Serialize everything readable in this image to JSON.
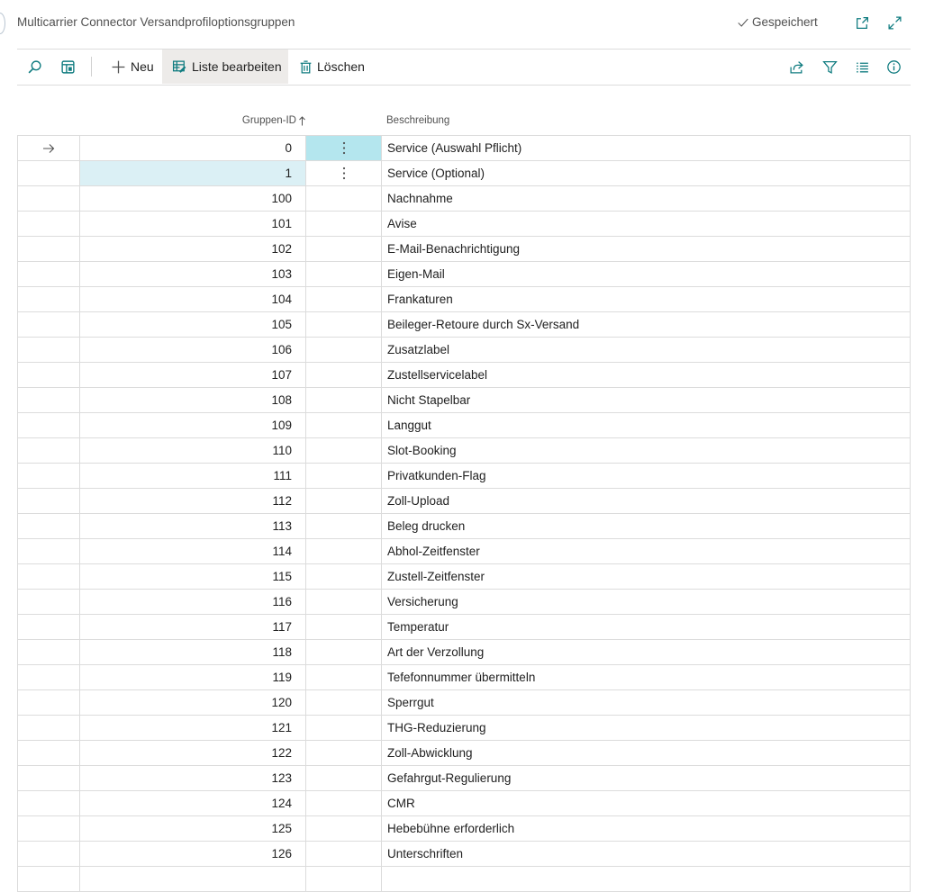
{
  "header": {
    "title": "Multicarrier Connector Versandprofiloptionsgruppen",
    "saved_label": "Gespeichert"
  },
  "toolbar": {
    "new_label": "Neu",
    "edit_list_label": "Liste bearbeiten",
    "delete_label": "Löschen"
  },
  "columns": {
    "group_id": "Gruppen-ID",
    "description": "Beschreibung"
  },
  "colors": {
    "accent": "#107c80",
    "current_cell": "#b4e6ee",
    "selected_cell": "#dbf0f5",
    "toolbar_active": "#edebe9"
  },
  "icons": {
    "search": "search-icon",
    "layout": "layout-icon",
    "new": "plus-icon",
    "edit_list": "edit-list-icon",
    "delete": "trash-icon",
    "share": "share-icon",
    "filter": "filter-icon",
    "list": "list-icon",
    "info": "info-icon",
    "popout": "open-new-window-icon",
    "expand": "expand-icon",
    "saved": "checkmark-icon",
    "sort": "sort-ascending-icon",
    "current_row": "arrow-right-icon",
    "row_menu": "more-vertical-icon"
  },
  "rows": [
    {
      "id": "0",
      "description": "Service (Auswahl Pflicht)"
    },
    {
      "id": "1",
      "description": "Service (Optional)"
    },
    {
      "id": "100",
      "description": "Nachnahme"
    },
    {
      "id": "101",
      "description": "Avise"
    },
    {
      "id": "102",
      "description": "E-Mail-Benachrichtigung"
    },
    {
      "id": "103",
      "description": "Eigen-Mail"
    },
    {
      "id": "104",
      "description": "Frankaturen"
    },
    {
      "id": "105",
      "description": "Beileger-Retoure durch Sx-Versand"
    },
    {
      "id": "106",
      "description": "Zusatzlabel"
    },
    {
      "id": "107",
      "description": "Zustellservicelabel"
    },
    {
      "id": "108",
      "description": "Nicht Stapelbar"
    },
    {
      "id": "109",
      "description": "Langgut"
    },
    {
      "id": "110",
      "description": "Slot-Booking"
    },
    {
      "id": "111",
      "description": "Privatkunden-Flag"
    },
    {
      "id": "112",
      "description": "Zoll-Upload"
    },
    {
      "id": "113",
      "description": "Beleg drucken"
    },
    {
      "id": "114",
      "description": "Abhol-Zeitfenster"
    },
    {
      "id": "115",
      "description": "Zustell-Zeitfenster"
    },
    {
      "id": "116",
      "description": "Versicherung"
    },
    {
      "id": "117",
      "description": "Temperatur"
    },
    {
      "id": "118",
      "description": "Art der Verzollung"
    },
    {
      "id": "119",
      "description": "Tefefonnummer übermitteln"
    },
    {
      "id": "120",
      "description": "Sperrgut"
    },
    {
      "id": "121",
      "description": "THG-Reduzierung"
    },
    {
      "id": "122",
      "description": "Zoll-Abwicklung"
    },
    {
      "id": "123",
      "description": "Gefahrgut-Regulierung"
    },
    {
      "id": "124",
      "description": "CMR"
    },
    {
      "id": "125",
      "description": "Hebebühne erforderlich"
    },
    {
      "id": "126",
      "description": "Unterschriften"
    },
    {
      "id": "",
      "description": ""
    }
  ]
}
